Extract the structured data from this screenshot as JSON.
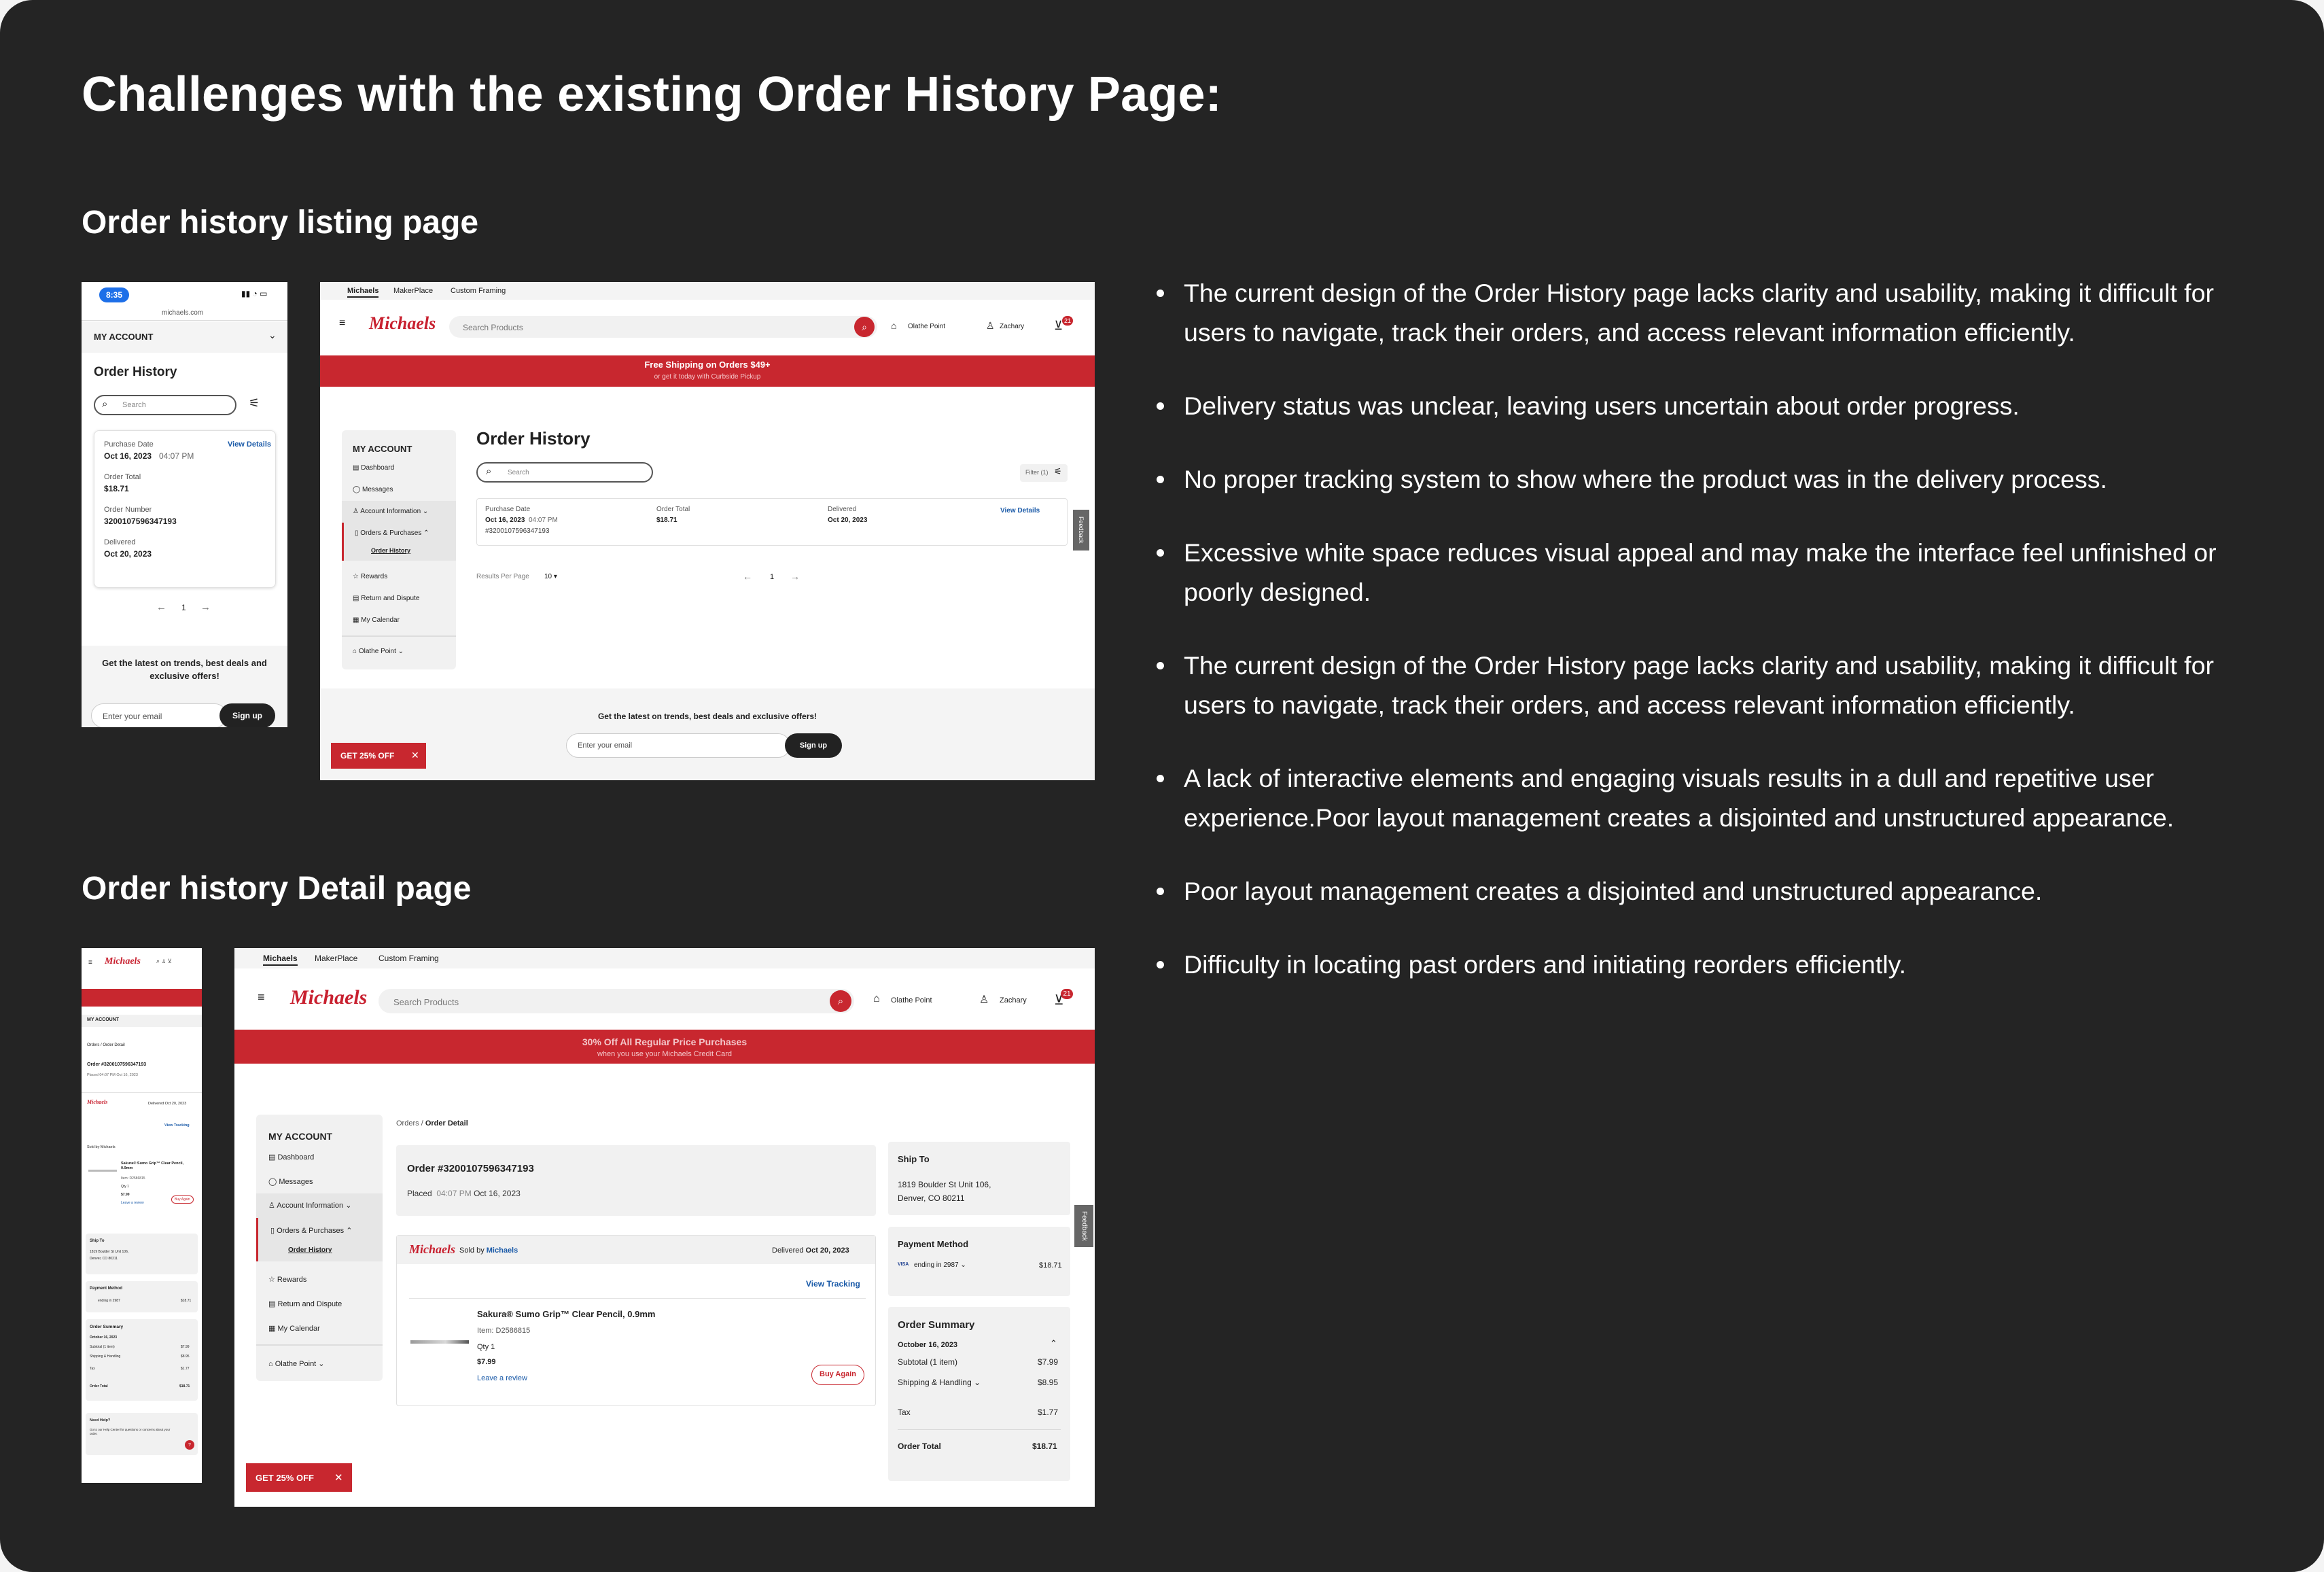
{
  "page": {
    "title": "Challenges with the existing Order History Page:",
    "listing_heading": "Order history listing page",
    "detail_heading": "Order history Detail page"
  },
  "colors": {
    "background": "#242424",
    "brand_red": "#c8202f",
    "text": "#ffffff"
  },
  "bullets": [
    "The current design of the Order History page lacks clarity and usability, making it difficult for users to navigate, track their orders, and access relevant information efficiently.",
    " Delivery status was unclear, leaving users uncertain about order progress.",
    "No proper tracking system to show where the product was in the delivery process.",
    "Excessive white space reduces visual appeal and may make the interface feel unfinished or poorly designed.",
    "The current design of the Order History page lacks clarity and usability, making it difficult for users to navigate, track their orders, and access relevant information efficiently.",
    "A lack of interactive elements and engaging visuals results in a dull and repetitive user experience.Poor layout management creates a disjointed and unstructured appearance.",
    "Poor layout management creates a disjointed and unstructured appearance.",
    "Difficulty in locating past orders and initiating reorders efficiently."
  ],
  "site": {
    "tabs": [
      "Michaels",
      "MakerPlace",
      "Custom Framing"
    ],
    "logo": "Michaels",
    "search_placeholder": "Search Products",
    "store": "Olathe Point",
    "user": "Zachary",
    "cart_count": "21",
    "promo_listing_title": "Free Shipping on Orders $49+",
    "promo_listing_sub": "or get it today with Curbside Pickup",
    "promo_detail_title": "30% Off All Regular Price Purchases",
    "promo_detail_sub": "when you use your Michaels Credit Card",
    "feedback": "Feedback",
    "coupon": "GET 25% OFF",
    "newsletter": "Get the latest on trends, best deals and exclusive offers!",
    "newsletter_mobile": "Get the latest on trends, best deals and exclusive offers!",
    "email_placeholder": "Enter your email",
    "signup": "Sign up"
  },
  "sidebar": {
    "title": "MY ACCOUNT",
    "items": [
      "Dashboard",
      "Messages",
      "Account Information",
      "Orders & Purchases",
      "Order History",
      "Rewards",
      "Return and Dispute",
      "My Calendar",
      "Olathe Point"
    ]
  },
  "mobile_listing": {
    "time": "8:35",
    "url": "michaels.com",
    "account": "MY ACCOUNT",
    "title": "Order History",
    "search": "Search",
    "purchase_date_label": "Purchase Date",
    "purchase_date": "Oct 16, 2023",
    "purchase_time": "04:07 PM",
    "view_details": "View Details",
    "order_total_label": "Order Total",
    "order_total": "$18.71",
    "order_number_label": "Order Number",
    "order_number": "3200107596347193",
    "delivered_label": "Delivered",
    "delivered": "Oct 20, 2023",
    "page": "1"
  },
  "desktop_listing": {
    "title": "Order History",
    "search": "Search",
    "filter": "Filter (1)",
    "purchase_date_label": "Purchase Date",
    "purchase_date": "Oct 16, 2023",
    "purchase_time": "04:07 PM",
    "order_number": "#3200107596347193",
    "order_total_label": "Order Total",
    "order_total": "$18.71",
    "delivered_label": "Delivered",
    "delivered": "Oct 20, 2023",
    "view_details": "View Details",
    "results_per_page": "Results Per Page",
    "per_page": "10",
    "page": "1"
  },
  "detail": {
    "breadcrumb_orders": "Orders",
    "breadcrumb_sep": "/",
    "breadcrumb_current": "Order Detail",
    "order_title": "Order #3200107596347193",
    "placed_label": "Placed",
    "placed_time": "04:07 PM",
    "placed_date": "Oct 16, 2023",
    "sold_by": "Sold by",
    "seller": "Michaels",
    "delivered_label": "Delivered",
    "delivered": "Oct 20, 2023",
    "view_tracking": "View Tracking",
    "product_name": "Sakura® Sumo Grip™ Clear Pencil, 0.9mm",
    "item": "Item: D2586815",
    "qty": "Qty 1",
    "price": "$7.99",
    "leave_review": "Leave a review",
    "buy_again": "Buy Again",
    "ship_to_title": "Ship To",
    "ship_line1": "1819 Boulder St Unit 106,",
    "ship_line2": "Denver, CO 80211",
    "payment_title": "Payment Method",
    "card_brand": "VISA",
    "card_ending": "ending in 2987",
    "payment_amount": "$18.71",
    "summary_title": "Order Summary",
    "summary_date": "October 16, 2023",
    "subtotal_label": "Subtotal (1 item)",
    "subtotal": "$7.99",
    "shipping_label": "Shipping & Handling",
    "shipping": "$8.95",
    "tax_label": "Tax",
    "tax": "$1.77",
    "total_label": "Order Total",
    "total": "$18.71"
  },
  "mobile_detail": {
    "breadcrumb": "Orders / Order Detail",
    "order_title": "Order #3200107596347193",
    "placed": "Placed 04:07 PM Oct 16, 2023",
    "delivered": "Delivered Oct 20, 2023",
    "sold_by": "Sold by Michaels",
    "view_tracking": "View Tracking",
    "product_name": "Sakura® Sumo Grip™ Clear Pencil, 0.9mm",
    "item": "Item: D2586815",
    "qty": "Qty 1",
    "price": "$7.99",
    "leave_review": "Leave a review",
    "buy_again": "Buy Again",
    "need_help": "Need Help?",
    "need_help_text": "Go to our Help Center for questions or concerns about your order."
  }
}
